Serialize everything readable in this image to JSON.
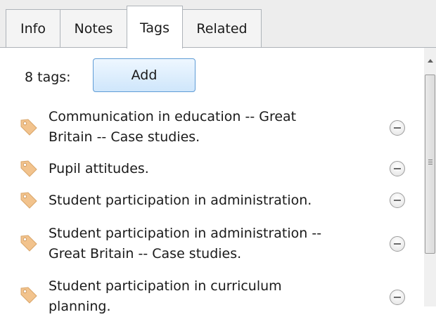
{
  "tabs": [
    {
      "label": "Info",
      "active": false
    },
    {
      "label": "Notes",
      "active": false
    },
    {
      "label": "Tags",
      "active": true
    },
    {
      "label": "Related",
      "active": false
    }
  ],
  "tags_panel": {
    "count_label": "8 tags:",
    "add_label": "Add",
    "tags": [
      {
        "line1": "Communication in education -- Great",
        "line2": "Britain -- Case studies."
      },
      {
        "line1": "Pupil attitudes.",
        "line2": ""
      },
      {
        "line1": "Student participation in administration.",
        "line2": ""
      },
      {
        "line1": "Student participation in administration --",
        "line2": "Great Britain -- Case studies."
      },
      {
        "line1": "Student participation in curriculum",
        "line2": "planning."
      }
    ]
  },
  "colors": {
    "tag_icon": "#f2c38d",
    "button_border": "#5f9cd6",
    "tab_border": "#aeb3b9"
  }
}
